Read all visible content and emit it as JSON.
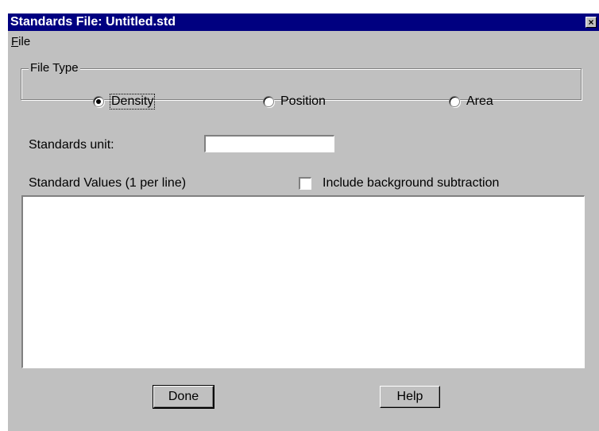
{
  "window": {
    "title": "Standards File: Untitled.std",
    "close_glyph": "×"
  },
  "menu": {
    "file_first": "F",
    "file_rest": "ile"
  },
  "file_type": {
    "label": "File Type",
    "options": [
      "Density",
      "Position",
      "Area"
    ],
    "selected": "Density"
  },
  "standards_unit": {
    "label": "Standards unit:",
    "value": ""
  },
  "standard_values": {
    "label": "Standard Values (1 per line)",
    "value": ""
  },
  "background_subtraction": {
    "label": "Include background subtraction",
    "checked": false
  },
  "buttons": {
    "done": "Done",
    "help": "Help"
  }
}
